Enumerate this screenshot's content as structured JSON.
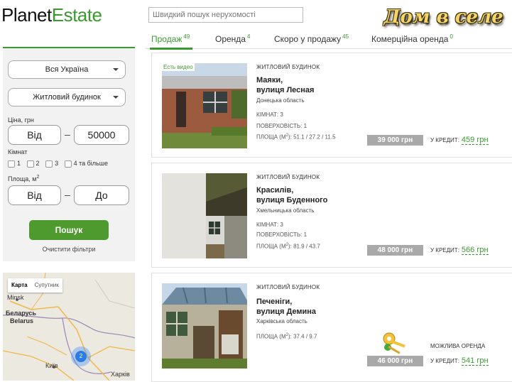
{
  "header": {
    "logo_part1": "Planet",
    "logo_part2": "Estate",
    "search_placeholder": "Швидкий пошук нерухомості",
    "banner": "Дом в селе"
  },
  "tabs": [
    {
      "label": "Продаж",
      "count": "49"
    },
    {
      "label": "Оренда",
      "count": "4"
    },
    {
      "label": "Скоро у продажу",
      "count": "45"
    },
    {
      "label": "Комерційна оренда",
      "count": "0"
    }
  ],
  "filters": {
    "region": "Вся Україна",
    "type": "Житловий будинок",
    "price_label": "Ціна, грн",
    "price_from": "Від",
    "price_to": "50000",
    "rooms_label": "Кімнат",
    "rooms": [
      "1",
      "2",
      "3",
      "4 та більше"
    ],
    "area_label": "Площа, м",
    "area_sup": "2",
    "area_from": "Від",
    "area_to": "До",
    "dash": "–",
    "search_button": "Пошук",
    "clear": "Очистити фільтри"
  },
  "map": {
    "tab_map": "Карта",
    "tab_satellite": "Супутник",
    "labels": {
      "minsk": "Minsk",
      "belarus1": "Беларусь",
      "belarus2": "Belarus",
      "kyiv": "Київ",
      "kharkiv": "Харків"
    },
    "cluster_count": "2"
  },
  "listings": [
    {
      "video": "Есть видео",
      "type": "ЖИТЛОВИЙ БУДИНОК",
      "title1": "Маяки,",
      "title2": "вулиця Лесная",
      "region": "Донецька область",
      "rooms": "КІМНАТ: 3",
      "floors": "ПОВЕРХОВІСТЬ: 1",
      "area_prefix": "ПЛОЩА (М",
      "area_values": "): 51.1 / 27.2 / 11.5",
      "price": "39 000 грн",
      "credit_label": "У КРЕДИТ:",
      "credit_amount": "459 грн"
    },
    {
      "type": "ЖИТЛОВИЙ БУДИНОК",
      "title1": "Красилів,",
      "title2": "вулиця Буденного",
      "region": "Хмельницька область",
      "rooms": "КІМНАТ: 3",
      "floors": "ПОВЕРХОВІСТЬ: 1",
      "area_prefix": "ПЛОЩА (М",
      "area_values": "): 81.9 / 43.7",
      "price": "48 000 грн",
      "credit_label": "У КРЕДИТ:",
      "credit_amount": "566 грн"
    },
    {
      "type": "ЖИТЛОВИЙ БУДИНОК",
      "title1": "Печеніги,",
      "title2": "вулиця Демина",
      "region": "Харківська область",
      "area_prefix": "ПЛОЩА (М",
      "area_values": "): 37.4 / 9.7",
      "rent_note": "МОЖЛИВА ОРЕНДА",
      "price": "46 000 грн",
      "credit_label": "У КРЕДИТ:",
      "credit_amount": "541 грн"
    }
  ],
  "area_sup": "2",
  "colors": {
    "brand_green": "#3a9a2f",
    "button_green": "#4f9a2e",
    "price_gray": "#a9a9a9"
  }
}
